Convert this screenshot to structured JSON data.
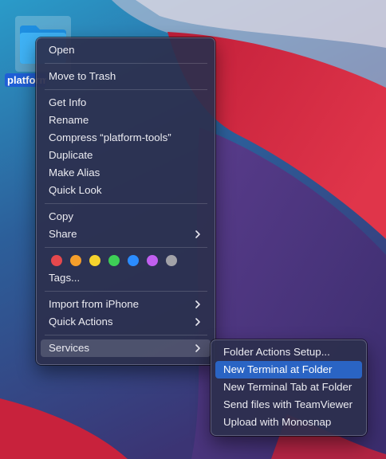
{
  "desktop": {
    "folder_label": "platform-tools"
  },
  "main_menu": {
    "group1": [
      {
        "label": "Open"
      }
    ],
    "group2": [
      {
        "label": "Move to Trash"
      }
    ],
    "group3": [
      {
        "label": "Get Info"
      },
      {
        "label": "Rename"
      },
      {
        "label": "Compress “platform-tools”"
      },
      {
        "label": "Duplicate"
      },
      {
        "label": "Make Alias"
      },
      {
        "label": "Quick Look"
      }
    ],
    "group4": [
      {
        "label": "Copy"
      },
      {
        "label": "Share"
      }
    ],
    "tag_colors": [
      {
        "name": "Red",
        "color": "#e5484d"
      },
      {
        "name": "Orange",
        "color": "#f59e2b"
      },
      {
        "name": "Yellow",
        "color": "#f6d32d"
      },
      {
        "name": "Green",
        "color": "#3ecf56"
      },
      {
        "name": "Blue",
        "color": "#2b8cff"
      },
      {
        "name": "Purple",
        "color": "#c15ff0"
      },
      {
        "name": "Gray",
        "color": "#a2a2a8"
      }
    ],
    "tags_label": "Tags...",
    "group6": [
      {
        "label": "Import from iPhone"
      },
      {
        "label": "Quick Actions"
      }
    ],
    "group7": [
      {
        "label": "Services"
      }
    ]
  },
  "services_menu": {
    "items": [
      {
        "label": "Folder Actions Setup..."
      },
      {
        "label": "New Terminal at Folder"
      },
      {
        "label": "New Terminal Tab at Folder"
      },
      {
        "label": "Send files with TeamViewer"
      },
      {
        "label": "Upload with Monosnap"
      }
    ]
  }
}
